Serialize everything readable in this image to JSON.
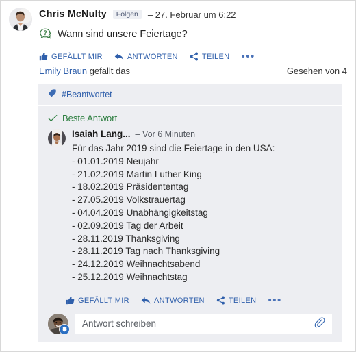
{
  "post": {
    "author": "Chris McNulty",
    "follow_label": "Folgen",
    "timestamp": "– 27. Februar um 6:22",
    "question": "Wann sind unsere Feiertage?",
    "question_icon": "question-bubble-icon",
    "actions": {
      "like": "GEFÄLLT MIR",
      "reply": "ANTWORTEN",
      "share": "TEILEN",
      "more": "•••"
    },
    "liker": "Emily Braun",
    "liker_suffix": " gefällt das",
    "seen": "Gesehen von 4"
  },
  "panel": {
    "tag": "#Beantwortet",
    "tag_icon": "tag-icon",
    "best_answer_label": "Beste Antwort",
    "best_answer_icon": "check-icon",
    "answer": {
      "author": "Isaiah Lang...",
      "timestamp": "– Vor 6 Minuten",
      "intro": "Für das Jahr 2019 sind die Feiertage in den USA:",
      "holidays": [
        "- 01.01.2019 Neujahr",
        "- 21.02.2019 Martin Luther King",
        "- 18.02.2019 Präsidententag",
        "- 27.05.2019 Volkstrauertag",
        "- 04.04.2019 Unabhängigkeitstag",
        "- 02.09.2019 Tag der Arbeit",
        "- 28.11.2019 Thanksgiving",
        "- 28.11.2019 Tag nach Thanksgiving",
        "- 24.12.2019 Weihnachtsabend",
        "- 25.12.2019 Weihnachtstag"
      ]
    },
    "actions": {
      "like": "GEFÄLLT MIR",
      "reply": "ANTWORTEN",
      "share": "TEILEN",
      "more": "•••"
    },
    "reply_placeholder": "Antwort schreiben",
    "attach_icon": "paperclip-icon"
  },
  "colors": {
    "link": "#2f5fab",
    "green": "#2b7d3e",
    "panel_bg": "#edeef2",
    "text": "#242424",
    "badge_blue": "#2b6fc2"
  }
}
